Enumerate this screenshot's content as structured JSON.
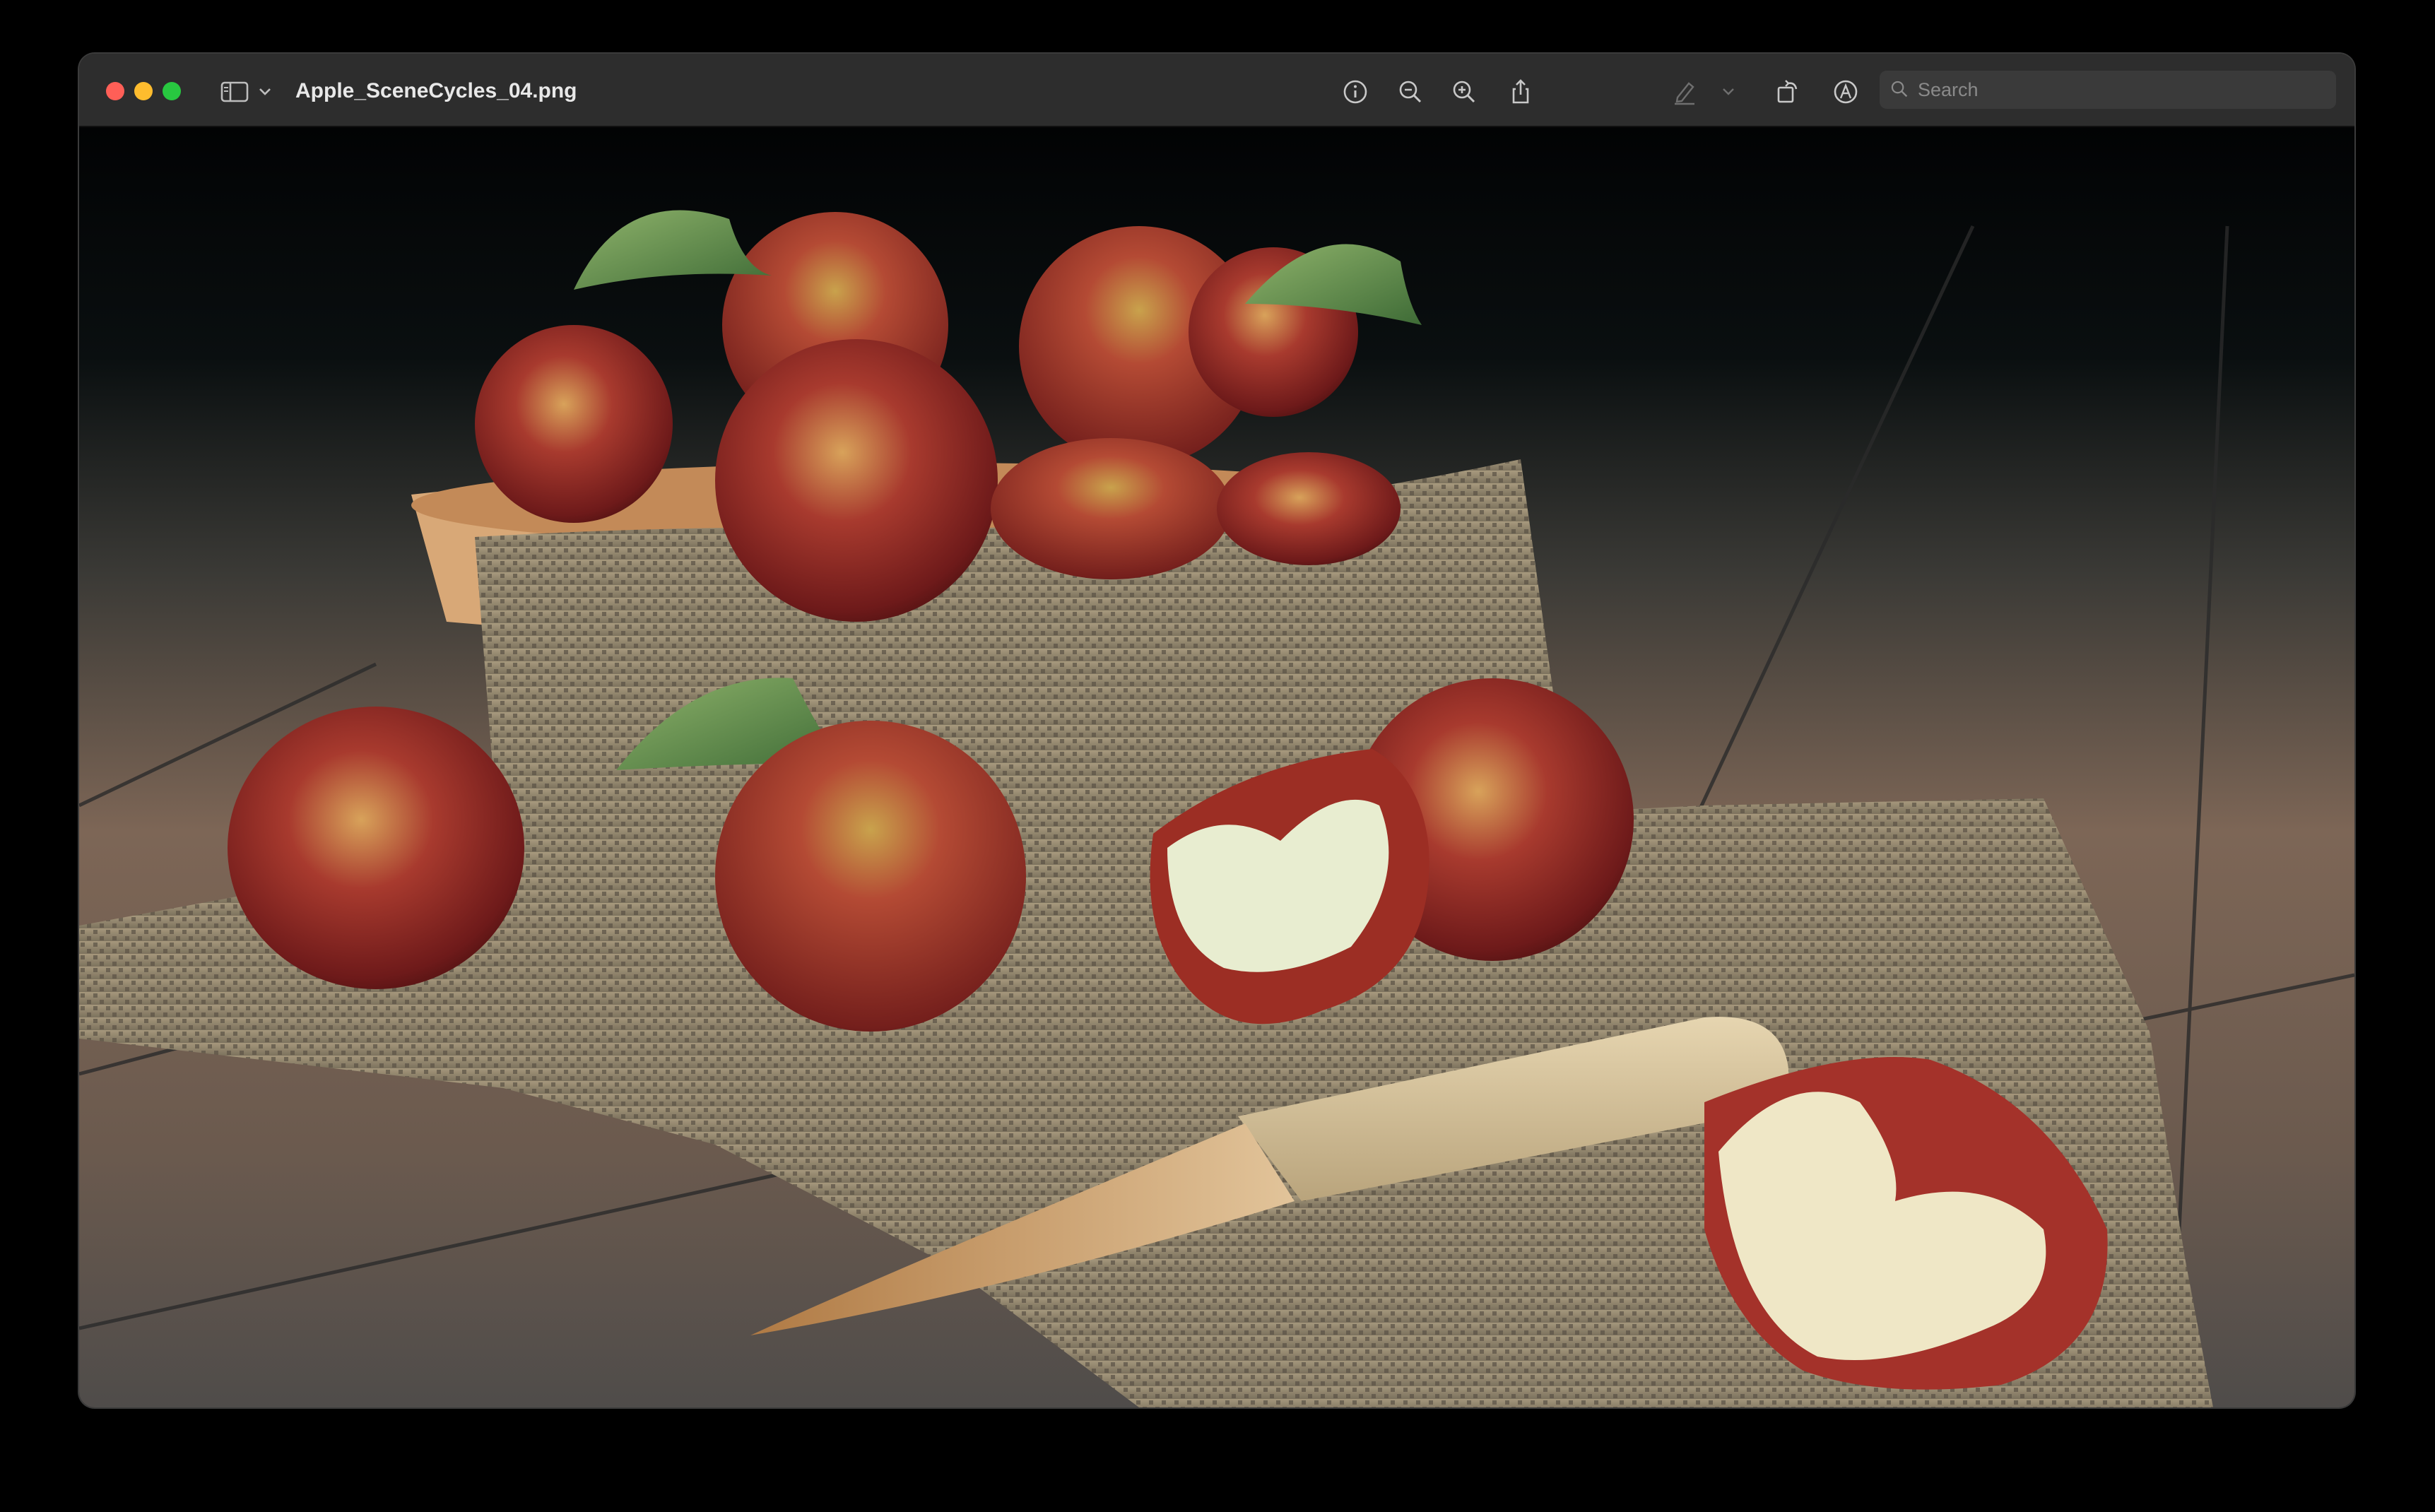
{
  "window": {
    "filename": "Apple_SceneCycles_04.png"
  },
  "toolbar": {
    "icons": [
      "sidebar-icon",
      "chevron-down-icon",
      "info-icon",
      "zoom-out-icon",
      "zoom-in-icon",
      "share-icon",
      "highlight-pen-icon",
      "chevron-down-icon",
      "rotate-icon",
      "markup-icon",
      "signature-icon"
    ]
  },
  "search": {
    "placeholder": "Search"
  },
  "colors": {
    "titlebar": "#2d2d2d",
    "close": "#ff5f57",
    "minimize": "#febc2e",
    "maximize": "#28c840"
  }
}
